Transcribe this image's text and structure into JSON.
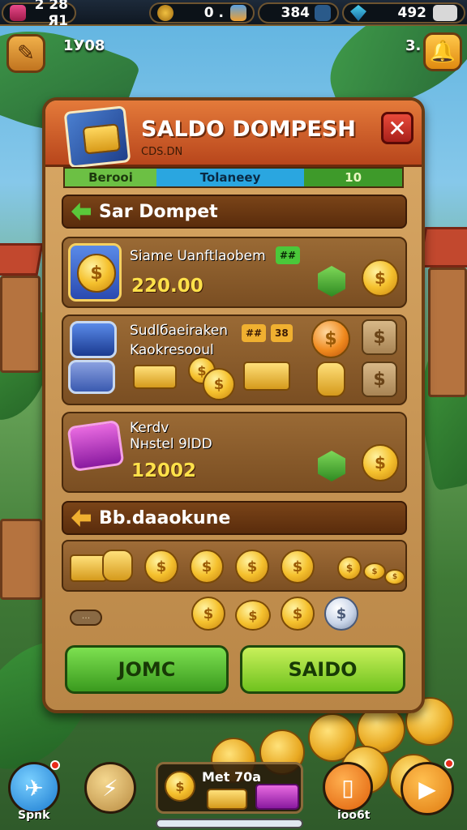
{
  "topbar": {
    "res1": {
      "icon": "gem-icon",
      "value": "2 28 Я1"
    },
    "res2": {
      "icon": "gear-icon",
      "value": "0 ."
    },
    "res3": {
      "icon": "shield-icon",
      "value": "384"
    },
    "res4": {
      "icon": "crystal-icon",
      "value": "492"
    }
  },
  "side": {
    "left_label": "1У08",
    "right_label": "3."
  },
  "panel": {
    "title": "SALDO DOMPESH",
    "subtitle": "CDS.DN",
    "tabs": [
      "Berooi",
      "Tolaneey",
      "10"
    ],
    "section1": "Sar Dompet",
    "card1": {
      "title": "Siame Uanftlaobem",
      "badge": "##",
      "value": "220.00"
    },
    "card2": {
      "title_line1": "Sudlбaeiraken",
      "title_line2": "Kaokresooul",
      "badge1": "## ",
      "badge2": "38"
    },
    "card3": {
      "title_line1": "Kerdv",
      "title_line2": "Nнstel 9lDD",
      "value": "12002"
    },
    "section2": "Bb.daaokune",
    "small_pill": "···",
    "btn_join": "JOMC",
    "btn_saldo": "SAIDO"
  },
  "bottom": {
    "left_label": "Spnk",
    "center_label": "Met 70a",
    "right_label": "ioo6t"
  },
  "colors": {
    "accent": "#e47a3a",
    "primary_green": "#3a9a1e",
    "gold": "#f5c12e"
  }
}
